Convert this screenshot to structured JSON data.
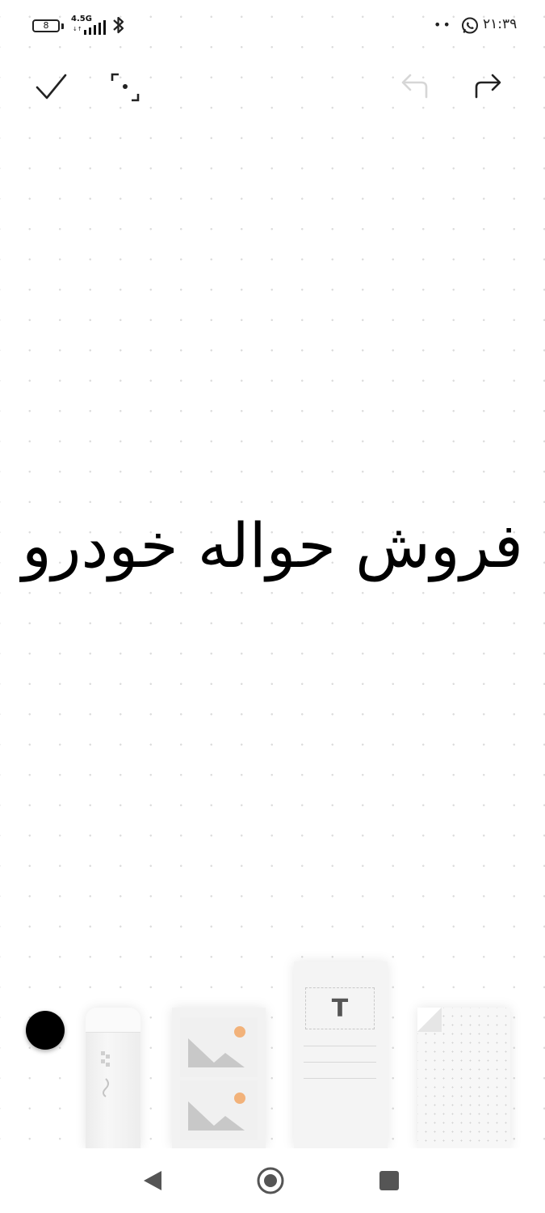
{
  "status_bar": {
    "battery_level": "8",
    "network_type": "4.5G",
    "network_arrows": "↓↑",
    "notification_dots": "••",
    "clock": "۲۱:۳۹",
    "icons": [
      "battery-icon",
      "signal-icon",
      "bluetooth-icon",
      "whatsapp-icon"
    ]
  },
  "toolbar": {
    "icons": [
      "check-icon",
      "fullscreen-icon",
      "undo-icon",
      "redo-icon"
    ],
    "undo_enabled": false,
    "redo_enabled": true
  },
  "canvas": {
    "background": "dot-grid",
    "text": "فروش حواله خودرو"
  },
  "tools": {
    "selected_color": "#000000",
    "text_tool_glyph": "T",
    "items": [
      "eraser-tool",
      "image-tool",
      "text-tool",
      "paper-tool"
    ]
  },
  "nav_bar": {
    "icons": [
      "back-icon",
      "home-icon",
      "recents-icon"
    ]
  }
}
